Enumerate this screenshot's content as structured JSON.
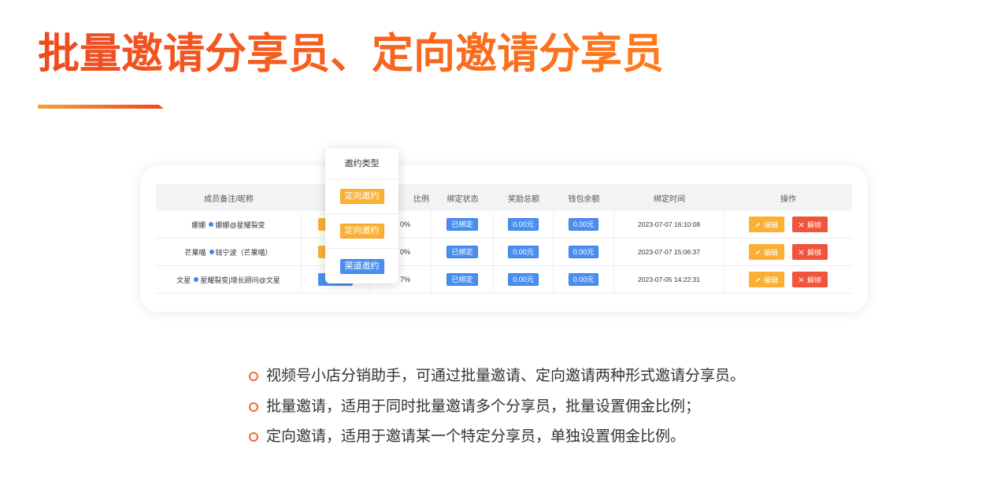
{
  "slide": {
    "title": "批量邀请分享员、定向邀请分享员",
    "bullets": [
      "视频号小店分销助手，可通过批量邀请、定向邀请两种形式邀请分享员。",
      "批量邀请，适用于同时批量邀请多个分享员，批量设置佣金比例；",
      "定向邀请，适用于邀请某一个特定分享员，单独设置佣金比例。"
    ]
  },
  "colors": {
    "title_start": "#EE4A22",
    "title_end": "#FF7A1C",
    "accent_orange": "#FBB034",
    "accent_blue": "#4A8FF0",
    "accent_red": "#F0543A",
    "bullet_ring": "#F26A2E",
    "header_bg": "#F2F3F5"
  },
  "icons": {
    "edit": "pencil-icon",
    "unbind": "close-icon",
    "bullet": "circle-ring-icon",
    "nickname_marker": "dot-icon"
  },
  "table": {
    "headers": {
      "member": "成员备注/昵称",
      "ratio": "比例",
      "status": "绑定状态",
      "reward": "奖励总额",
      "balance": "钱包余额",
      "time": "绑定时间",
      "actions": "操作"
    },
    "rows": [
      {
        "name": "娜娜",
        "nickname": "娜娜@星耀裂变",
        "invite_tag_color": "#FBB034",
        "ratio": "0%",
        "status": "已绑定",
        "reward": "0.00元",
        "balance": "0.00元",
        "time": "2023-07-07 16:10:08",
        "edit_label": "编辑",
        "unbind_label": "解绑"
      },
      {
        "name": "芒果喵",
        "nickname": "钱宁波（芒果喵）",
        "invite_tag_color": "#FBB034",
        "ratio": "0%",
        "status": "已绑定",
        "reward": "0.00元",
        "balance": "0.00元",
        "time": "2023-07-07 15:06:37",
        "edit_label": "编辑",
        "unbind_label": "解绑"
      },
      {
        "name": "文星",
        "nickname": "星耀裂变|增长顾问@文星",
        "invite_tag_color": "#4A8FF0",
        "ratio": "7%",
        "status": "已绑定",
        "reward": "0.00元",
        "balance": "0.00元",
        "time": "2023-07-05 14:22:31",
        "edit_label": "编辑",
        "unbind_label": "解绑"
      }
    ]
  },
  "popup": {
    "title": "邀约类型",
    "options": [
      {
        "label": "定向邀约",
        "color": "#FBB034"
      },
      {
        "label": "定向邀约",
        "color": "#FBB034"
      },
      {
        "label": "渠道邀约",
        "color": "#4A8FF0"
      }
    ]
  }
}
